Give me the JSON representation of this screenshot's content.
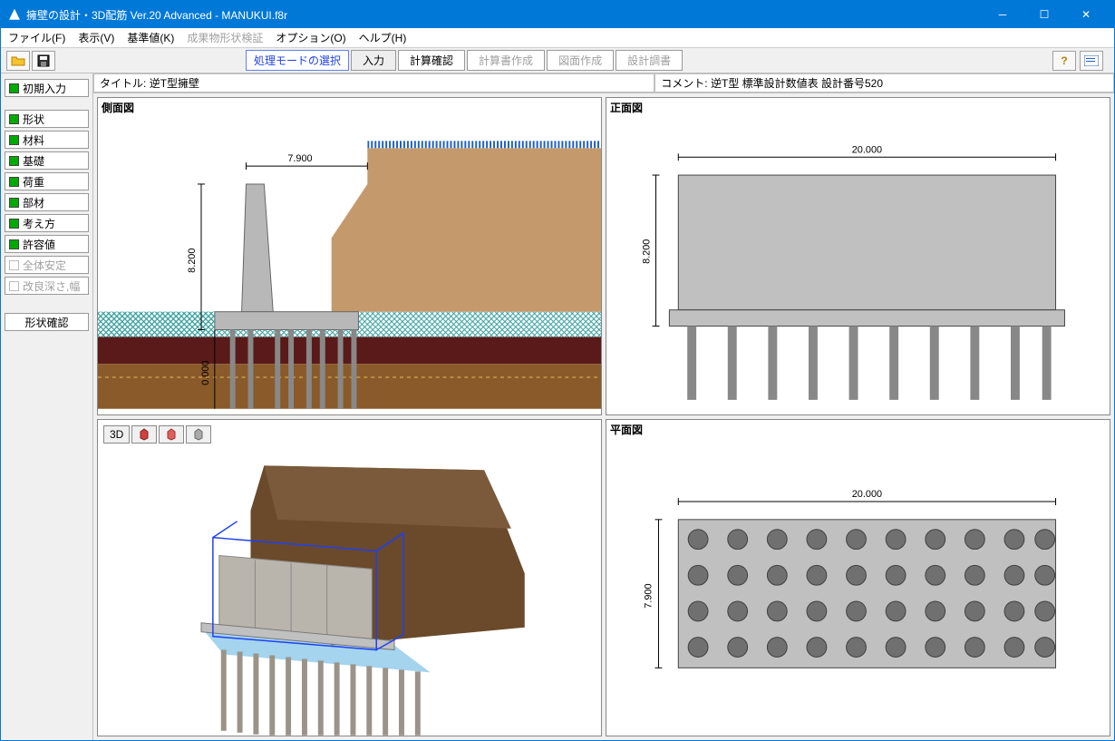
{
  "window": {
    "title": "擁壁の設計・3D配筋 Ver.20 Advanced  -  MANUKUI.f8r"
  },
  "menu": {
    "file": "ファイル(F)",
    "view": "表示(V)",
    "criteria": "基準値(K)",
    "verify": "成果物形状検証",
    "option": "オプション(O)",
    "help": "ヘルプ(H)"
  },
  "mode": {
    "label": "処理モードの選択",
    "input": "入力",
    "calc_check": "計算確認",
    "calc_report": "計算書作成",
    "drawing": "図面作成",
    "design_report": "設計調書"
  },
  "sidebar": {
    "initial": "初期入力",
    "shape": "形状",
    "material": "材料",
    "foundation": "基礎",
    "load": "荷重",
    "member": "部材",
    "method": "考え方",
    "allowable": "許容値",
    "global": "全体安定",
    "improve": "改良深さ,幅",
    "confirm": "形状確認"
  },
  "info": {
    "title_label": "タイトル:",
    "title_value": "逆T型擁壁",
    "comment_label": "コメント:",
    "comment_value": "逆T型 標準設計数値表 設計番号520"
  },
  "views": {
    "side": "側面図",
    "front": "正面図",
    "threed": "3D",
    "plan": "平面図"
  },
  "dimensions": {
    "side_width": "7.900",
    "side_height": "8.200",
    "side_depth": "0.000",
    "front_width": "20.000",
    "front_height": "8.200",
    "plan_width": "20.000",
    "plan_height": "7.900"
  }
}
